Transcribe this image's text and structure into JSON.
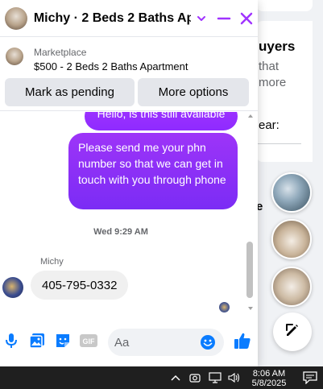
{
  "chat_header": {
    "title": "Michy · 2 Beds 2 Baths Ap...",
    "icons": [
      "chevron-down-icon",
      "minimize-icon",
      "close-icon"
    ]
  },
  "listing": {
    "label": "Marketplace",
    "title": "$500 - 2 Beds 2 Baths Apartment",
    "mark_pending": "Mark as pending",
    "more_options": "More options"
  },
  "thread": {
    "partial_message": "Hello, is this still available",
    "outgoing_message": "Please send me your phn number so that we can get in touch with you through phone",
    "timestamp": "Wed 9:29 AM",
    "sender_name": "Michy",
    "incoming_message": "405-795-0332"
  },
  "composer": {
    "placeholder": "Aa",
    "icons": [
      "microphone-icon",
      "photo-icon",
      "sticker-icon",
      "gif-icon",
      "emoji-icon",
      "thumbs-up-icon"
    ]
  },
  "background": {
    "heading_fragment": "uyers",
    "line1": "that",
    "line2": "more",
    "line3": "ear:",
    "fragment": "e"
  },
  "taskbar": {
    "time": "8:06 AM",
    "date": "5/8/2025"
  },
  "colors": {
    "accent": "#a033ff",
    "messenger_purple": "#8f2bff",
    "messenger_blue": "#0a7cff",
    "taskbar": "#1f1f1f"
  }
}
